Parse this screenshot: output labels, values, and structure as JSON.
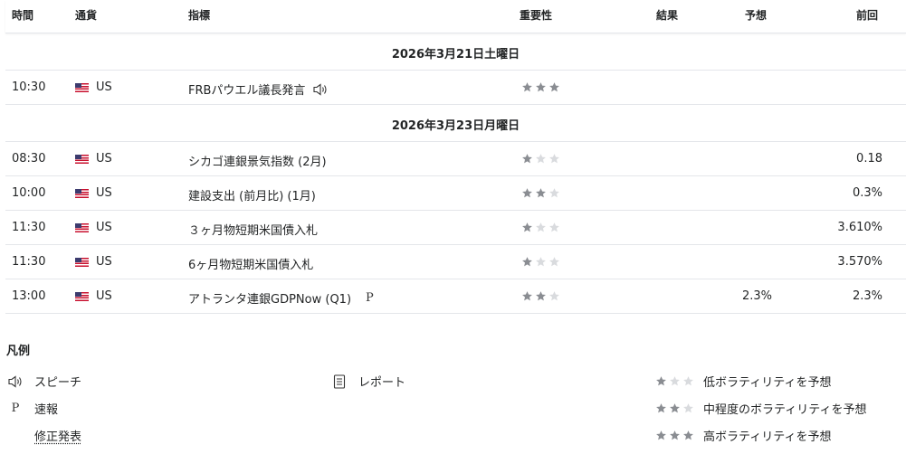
{
  "header": {
    "time": "時間",
    "currency": "通貨",
    "indicator": "指標",
    "importance": "重要性",
    "actual": "結果",
    "forecast": "予想",
    "previous": "前回"
  },
  "days": [
    {
      "date": "2026年3月21日土曜日",
      "events": [
        {
          "time": "10:30",
          "currency": "US",
          "event": "FRBパウエル議長発言",
          "tag": "speech",
          "importance": 3,
          "actual": "",
          "forecast": "",
          "previous": ""
        }
      ]
    },
    {
      "date": "2026年3月23日月曜日",
      "events": [
        {
          "time": "08:30",
          "currency": "US",
          "event": "シカゴ連銀景気指数 (2月)",
          "tag": "",
          "importance": 1,
          "actual": "",
          "forecast": "",
          "previous": "0.18"
        },
        {
          "time": "10:00",
          "currency": "US",
          "event": "建設支出 (前月比) (1月)",
          "tag": "",
          "importance": 2,
          "actual": "",
          "forecast": "",
          "previous": "0.3%"
        },
        {
          "time": "11:30",
          "currency": "US",
          "event": "３ヶ月物短期米国債入札",
          "tag": "",
          "importance": 1,
          "actual": "",
          "forecast": "",
          "previous": "3.610%"
        },
        {
          "time": "11:30",
          "currency": "US",
          "event": "6ヶ月物短期米国債入札",
          "tag": "",
          "importance": 1,
          "actual": "",
          "forecast": "",
          "previous": "3.570%"
        },
        {
          "time": "13:00",
          "currency": "US",
          "event": "アトランタ連銀GDPNow (Q1)",
          "tag": "P",
          "importance": 2,
          "actual": "",
          "forecast": "2.3%",
          "previous": "2.3%"
        }
      ]
    }
  ],
  "legend": {
    "title": "凡例",
    "speech": "スピーチ",
    "report": "レポート",
    "preliminary_symbol": "P",
    "preliminary": "速報",
    "revised": "修正発表",
    "low": "低ボラティリティを予想",
    "medium": "中程度のボラティリティを予想",
    "high": "高ボラティリティを予想"
  },
  "colors": {
    "star_on": "#8a8d92",
    "star_off": "#d9dbde",
    "border": "#e4e6ea",
    "text": "#232526"
  },
  "icons": {
    "speech": "speaker-icon",
    "report": "document-icon",
    "flag": "us-flag-icon",
    "importance": "star-icon"
  }
}
